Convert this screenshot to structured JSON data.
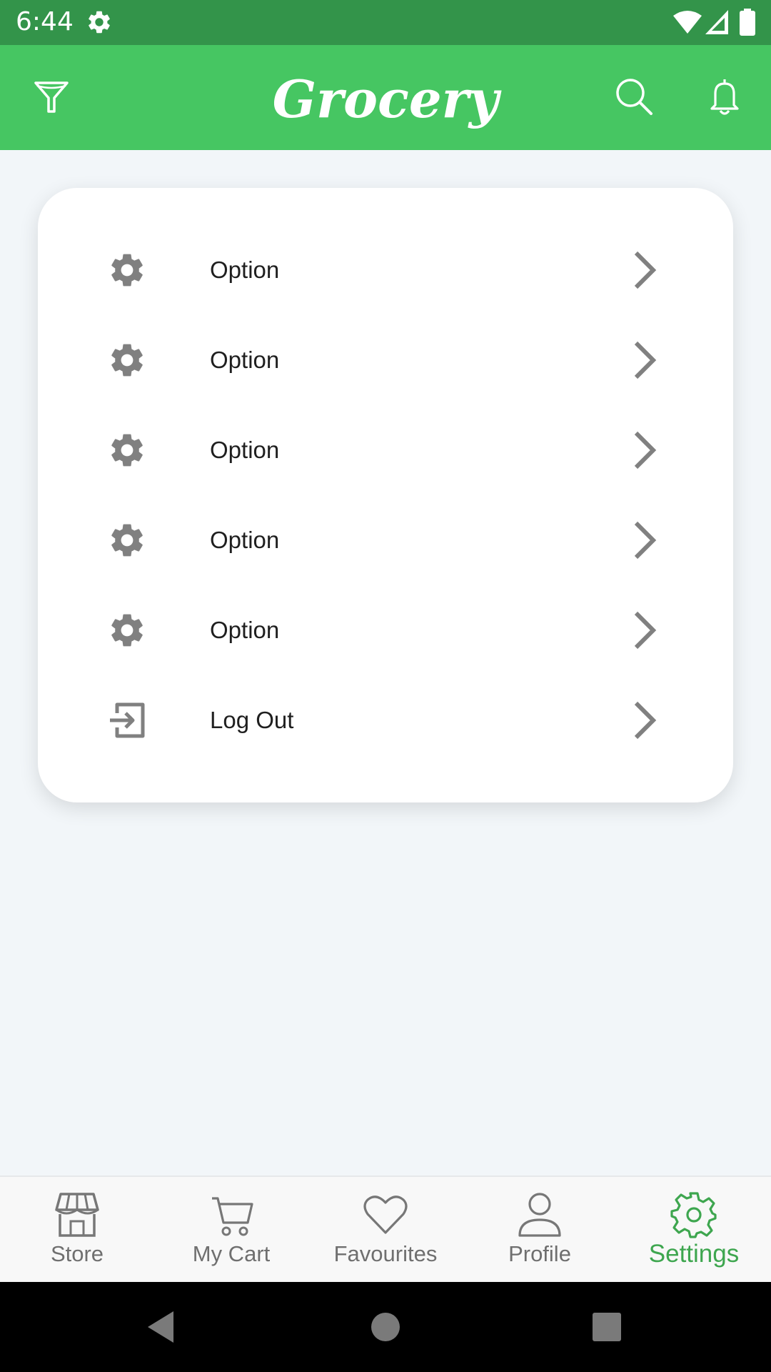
{
  "status_bar": {
    "time": "6:44",
    "icons": [
      "settings-icon",
      "wifi-icon",
      "signal-icon",
      "battery-icon"
    ]
  },
  "app_bar": {
    "title": "Grocery",
    "left_icon": "filter-icon",
    "right_icons": [
      "search-icon",
      "bell-icon"
    ],
    "color": "#46c662"
  },
  "settings_list": {
    "items": [
      {
        "label": "Option",
        "icon": "gear-icon"
      },
      {
        "label": "Option",
        "icon": "gear-icon"
      },
      {
        "label": "Option",
        "icon": "gear-icon"
      },
      {
        "label": "Option",
        "icon": "gear-icon"
      },
      {
        "label": "Option",
        "icon": "gear-icon"
      },
      {
        "label": "Log Out",
        "icon": "logout-icon"
      }
    ]
  },
  "bottom_nav": {
    "items": [
      {
        "label": "Store",
        "icon": "store-icon"
      },
      {
        "label": "My Cart",
        "icon": "cart-icon"
      },
      {
        "label": "Favourites",
        "icon": "heart-icon"
      },
      {
        "label": "Profile",
        "icon": "profile-icon"
      },
      {
        "label": "Settings",
        "icon": "settings-icon"
      }
    ],
    "active": "Settings",
    "active_color": "#3ea64f"
  },
  "system_nav": {
    "buttons": [
      "back-icon",
      "home-icon",
      "recents-icon"
    ]
  },
  "colors": {
    "status_bar": "#33944a",
    "app_bar": "#46c662",
    "background": "#f2f6f9",
    "icon_gray": "#808080"
  }
}
